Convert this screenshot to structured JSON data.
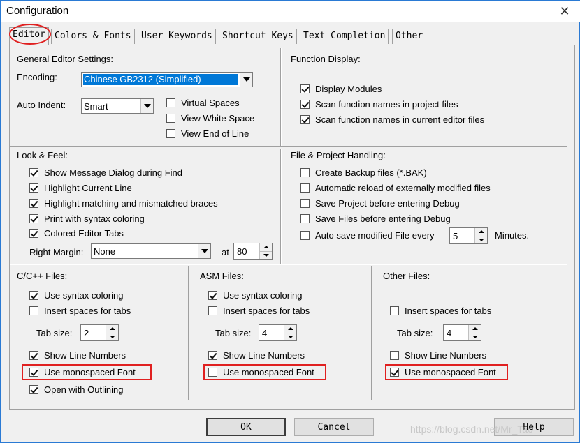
{
  "window": {
    "title": "Configuration",
    "close_glyph": "✕"
  },
  "tabs": [
    {
      "label": "Editor"
    },
    {
      "label": "Colors & Fonts"
    },
    {
      "label": "User Keywords"
    },
    {
      "label": "Shortcut Keys"
    },
    {
      "label": "Text Completion"
    },
    {
      "label": "Other"
    }
  ],
  "general": {
    "heading": "General Editor Settings:",
    "encoding_label": "Encoding:",
    "encoding_value": "Chinese GB2312 (Simplified)",
    "auto_indent_label": "Auto Indent:",
    "auto_indent_value": "Smart",
    "checkboxes": [
      {
        "label": "Virtual Spaces",
        "checked": false
      },
      {
        "label": "View White Space",
        "checked": false
      },
      {
        "label": "View End of Line",
        "checked": false
      }
    ]
  },
  "function_display": {
    "heading": "Function Display:",
    "checkboxes": [
      {
        "label": "Display Modules",
        "checked": true
      },
      {
        "label": "Scan function names in project files",
        "checked": true
      },
      {
        "label": "Scan function names in current editor files",
        "checked": true
      }
    ]
  },
  "look_feel": {
    "heading": "Look & Feel:",
    "checkboxes": [
      {
        "label": "Show Message Dialog during Find",
        "checked": true
      },
      {
        "label": "Highlight Current Line",
        "checked": true
      },
      {
        "label": "Highlight matching and mismatched braces",
        "checked": true
      },
      {
        "label": "Print with syntax coloring",
        "checked": true
      },
      {
        "label": "Colored Editor Tabs",
        "checked": true
      }
    ],
    "right_margin_label": "Right Margin:",
    "right_margin_value": "None",
    "at_label": "at",
    "at_value": "80"
  },
  "file_project": {
    "heading": "File & Project Handling:",
    "checkboxes": [
      {
        "label": "Create Backup files (*.BAK)",
        "checked": false
      },
      {
        "label": "Automatic reload of externally modified files",
        "checked": false
      },
      {
        "label": "Save Project before entering Debug",
        "checked": false
      },
      {
        "label": "Save Files before entering Debug",
        "checked": false
      },
      {
        "label": "Auto save modified File every",
        "checked": false
      }
    ],
    "autosave_value": "5",
    "minutes_label": "Minutes."
  },
  "cpp_files": {
    "heading": "C/C++ Files:",
    "syntax": {
      "label": "Use syntax coloring",
      "checked": true
    },
    "spaces": {
      "label": "Insert spaces for tabs",
      "checked": false
    },
    "tab_size_label": "Tab size:",
    "tab_size": "2",
    "line_numbers": {
      "label": "Show Line Numbers",
      "checked": true
    },
    "monospaced": {
      "label": "Use monospaced Font",
      "checked": true
    },
    "outlining": {
      "label": "Open with Outlining",
      "checked": true
    }
  },
  "asm_files": {
    "heading": "ASM Files:",
    "syntax": {
      "label": "Use syntax coloring",
      "checked": true
    },
    "spaces": {
      "label": "Insert spaces for tabs",
      "checked": false
    },
    "tab_size_label": "Tab size:",
    "tab_size": "4",
    "line_numbers": {
      "label": "Show Line Numbers",
      "checked": true
    },
    "monospaced": {
      "label": "Use monospaced Font",
      "checked": false
    }
  },
  "other_files": {
    "heading": "Other Files:",
    "spaces": {
      "label": "Insert spaces for tabs",
      "checked": false
    },
    "tab_size_label": "Tab size:",
    "tab_size": "4",
    "line_numbers": {
      "label": "Show Line Numbers",
      "checked": false
    },
    "monospaced": {
      "label": "Use monospaced Font",
      "checked": true
    }
  },
  "buttons": {
    "ok": "OK",
    "cancel": "Cancel",
    "help": "Help"
  },
  "watermark": "https://blog.csdn.net/Mr_Tao",
  "colors": {
    "accent": "#0078d7",
    "highlight_red": "#e02020"
  }
}
